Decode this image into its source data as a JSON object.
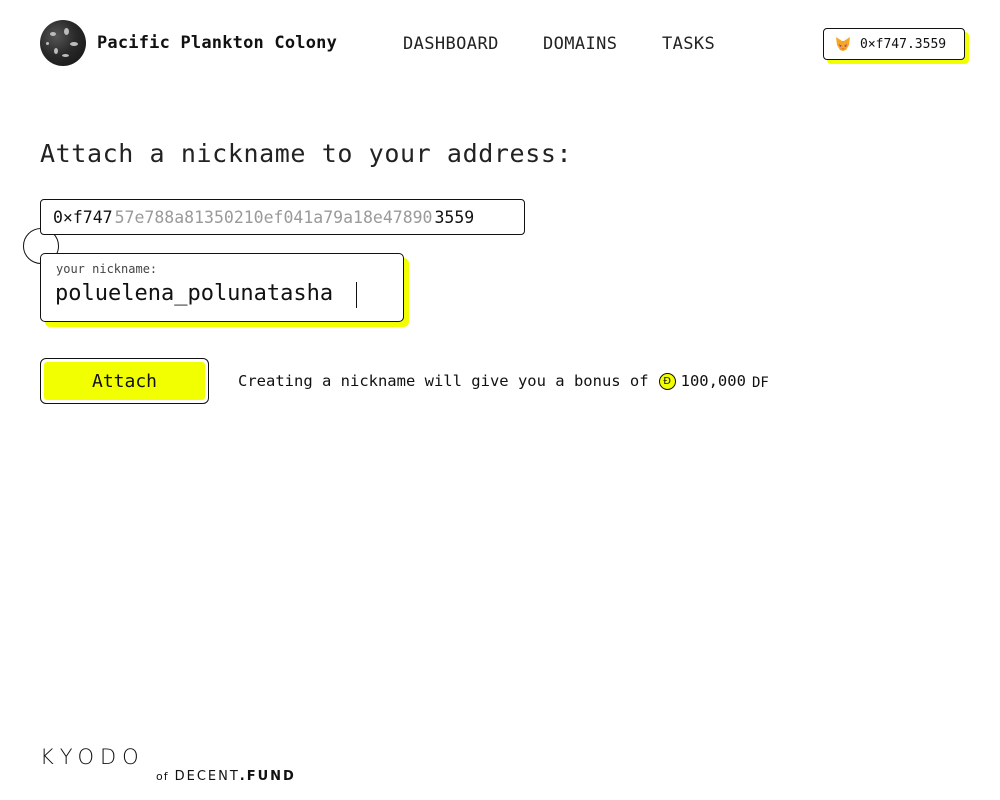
{
  "header": {
    "app_name": "Pacific Plankton Colony",
    "nav": [
      "DASHBOARD",
      "DOMAINS",
      "TASKS"
    ],
    "wallet_label": "0×f747.3559",
    "wallet_icon": "fox-icon",
    "logo_icon": "plankton-logo"
  },
  "main": {
    "title": "Attach a nickname to your address:",
    "address": {
      "prefix": "0×f747",
      "middle": "57e788a81350210ef041a79a18e47890",
      "suffix": "3559"
    },
    "nickname_field": {
      "label": "your nickname:",
      "value": "poluelena_polunatasha"
    },
    "attach_label": "Attach",
    "bonus": {
      "text": "Creating a nickname will give you a bonus of",
      "coin_symbol": "Ð",
      "amount": "100,000",
      "unit": "DF"
    }
  },
  "footer": {
    "brand": "KYODO",
    "of": "of",
    "decent": "DECENT",
    "fund": ".FUND"
  },
  "colors": {
    "accent": "#f2ff00",
    "text": "#111111",
    "muted": "#9a9a9a"
  }
}
